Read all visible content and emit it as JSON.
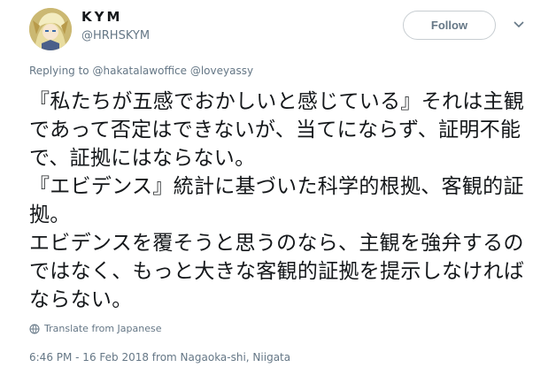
{
  "author": {
    "name": "KYM",
    "handle": "@HRHSKYM"
  },
  "follow_label": "Follow",
  "reply": {
    "prefix": "Replying to",
    "mentions": "@hakatalawoffice @loveyassy"
  },
  "tweet_text": "『私たちが五感でおかしいと感じている』それは主観であって否定はできないが、当てにならず、証明不能で、証拠にはならない。\n『エビデンス』統計に基づいた科学的根拠、客観的証拠。\nエビデンスを覆そうと思うのなら、主観を強弁するのではなく、もっと大きな客観的証拠を提示しなければならない。",
  "translate_label": "Translate from Japanese",
  "timestamp": "6:46 PM - 16 Feb 2018 from Nagaoka-shi, Niigata",
  "icons": {
    "avatar": "anime-character-avatar",
    "caret": "chevron-down-icon",
    "translate": "globe-icon"
  },
  "colors": {
    "text": "#14171a",
    "secondary": "#657786",
    "border": "#c7cdd1"
  }
}
